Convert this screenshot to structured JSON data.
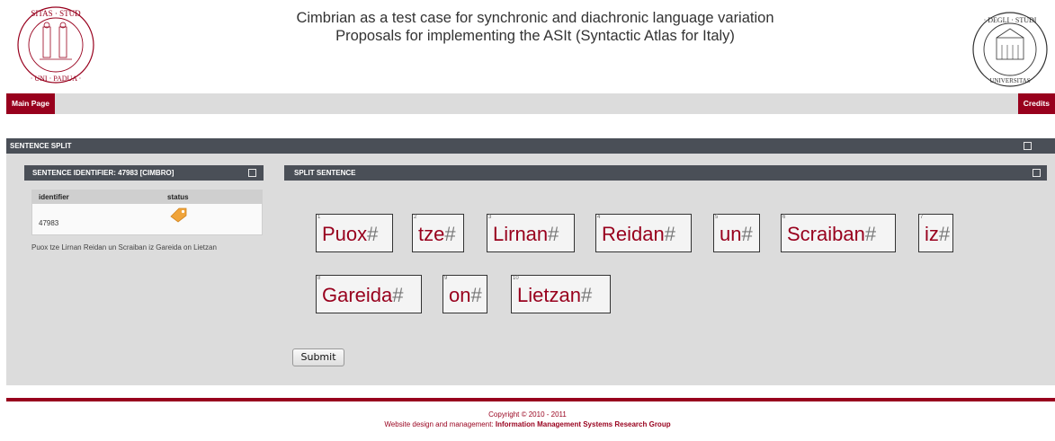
{
  "header": {
    "title_line1": "Cimbrian as a test case for synchronic and diachronic language variation",
    "title_line2": "Proposals for implementing the ASIt (Syntactic Atlas for Italy)"
  },
  "nav": {
    "main_page": "Main Page",
    "credits": "Credits"
  },
  "panel": {
    "title": "SENTENCE SPLIT",
    "identifier_title": "SENTENCE IDENTIFIER: 47983 [CIMBRO]",
    "split_title": "SPLIT SENTENCE",
    "table": {
      "headers": [
        "identifier",
        "status"
      ],
      "row": {
        "identifier": "47983",
        "status_icon": "tag-icon"
      }
    },
    "sentence": "Puox tze Lirnan Reidan un Scraiban iz Gareida on Lietzan",
    "words": [
      {
        "num": "1",
        "text": "Puox"
      },
      {
        "num": "2",
        "text": "tze"
      },
      {
        "num": "3",
        "text": "Lirnan"
      },
      {
        "num": "4",
        "text": "Reidan"
      },
      {
        "num": "5",
        "text": "un"
      },
      {
        "num": "6",
        "text": "Scraiban"
      },
      {
        "num": "7",
        "text": "iz"
      },
      {
        "num": "8",
        "text": "Gareida"
      },
      {
        "num": "9",
        "text": "on"
      },
      {
        "num": "10",
        "text": "Lietzan"
      }
    ],
    "hash": "#",
    "submit": "Submit"
  },
  "footer": {
    "copyright": "Copyright © 2010 - 2011",
    "design_prefix": "Website design and management: ",
    "design_group": "Information Management Systems Research Group"
  },
  "colors": {
    "brand": "#98001d",
    "bar": "#4a4f57",
    "panel_bg": "#dcdcdc"
  }
}
